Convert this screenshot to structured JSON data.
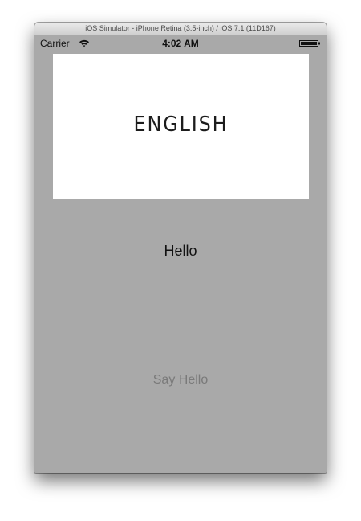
{
  "window": {
    "title": "iOS Simulator - iPhone Retina (3.5-inch) / iOS 7.1 (11D167)"
  },
  "status_bar": {
    "carrier": "Carrier",
    "time": "4:02 AM",
    "wifi_icon": "wifi-icon",
    "battery_icon": "battery-icon",
    "battery_level": 1.0
  },
  "content": {
    "image_text": "ENGLISH",
    "label": "Hello",
    "button_label": "Say Hello"
  },
  "colors": {
    "screen_background": "#a9a9a9",
    "button_text": "#7a7a7a"
  }
}
